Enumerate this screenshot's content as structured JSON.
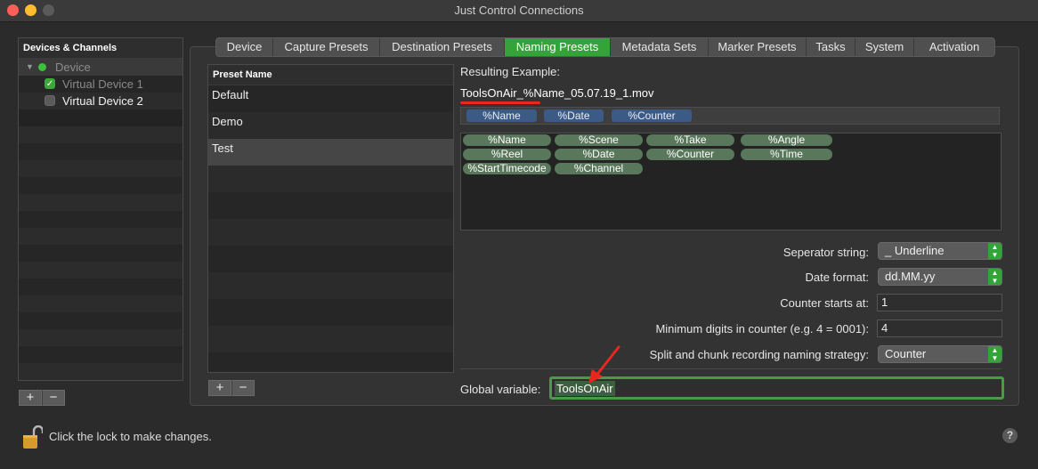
{
  "window": {
    "title": "Just Control Connections"
  },
  "devices": {
    "header": "Devices & Channels",
    "group_label": "Device",
    "items": [
      {
        "label": "Virtual Device 1",
        "checked": true
      },
      {
        "label": "Virtual Device 2",
        "checked": false
      }
    ],
    "add_label": "+",
    "remove_label": "−"
  },
  "tabs": [
    "Device",
    "Capture Presets",
    "Destination Presets",
    "Naming Presets",
    "Metadata Sets",
    "Marker Presets",
    "Tasks",
    "System",
    "Activation"
  ],
  "active_tab": "Naming Presets",
  "presets": {
    "header": "Preset Name",
    "items": [
      "Default",
      "Demo",
      "Test"
    ],
    "selected": "Test",
    "add_label": "+",
    "remove_label": "−"
  },
  "naming": {
    "result_label": "Resulting Example:",
    "result_value": "ToolsOnAir_%Name_05.07.19_1.mov",
    "chosen_tokens": [
      "%Name",
      "%Date",
      "%Counter"
    ],
    "available_tokens": [
      "%Name",
      "%Scene",
      "%Take",
      "%Angle",
      "%Reel",
      "%Date",
      "%Counter",
      "%Time",
      "%StartTimecode",
      "%Channel"
    ],
    "separator_label": "Seperator string:",
    "separator_value": "_ Underline",
    "date_format_label": "Date format:",
    "date_format_value": "dd.MM.yy",
    "counter_start_label": "Counter starts at:",
    "counter_start_value": "1",
    "min_digits_label": "Minimum digits in counter (e.g. 4 = 0001):",
    "min_digits_value": "4",
    "split_label": "Split and chunk recording naming strategy:",
    "split_value": "Counter",
    "global_var_label": "Global variable:",
    "global_var_value": "ToolsOnAir"
  },
  "footer": {
    "lock_text": "Click the lock to make changes.",
    "help_label": "?"
  },
  "colors": {
    "accent_green": "#34a33a",
    "annotation_red": "#e8281e",
    "token_blue": "#3b5a86",
    "token_green": "#59775a"
  }
}
